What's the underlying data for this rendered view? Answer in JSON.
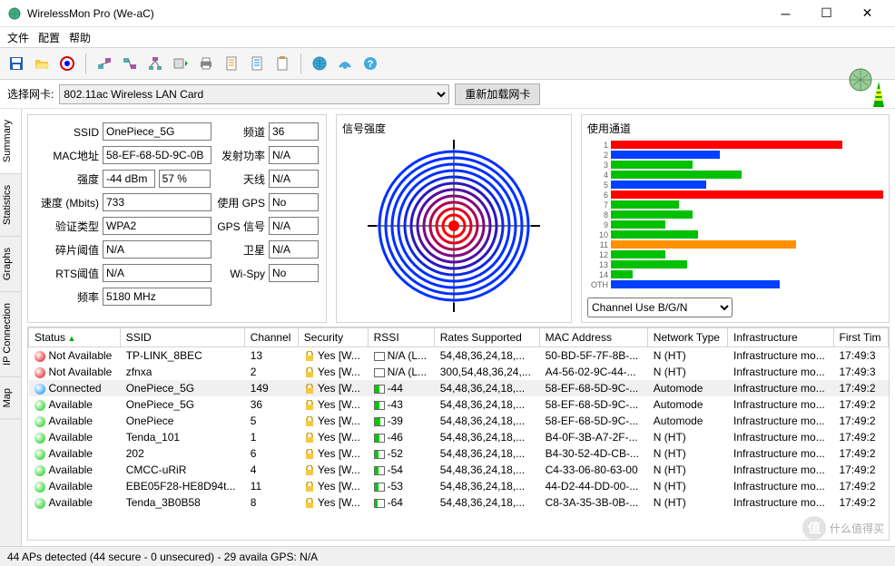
{
  "window": {
    "title": "WirelessMon Pro (We-aC)"
  },
  "menu": {
    "file": "文件",
    "config": "配置",
    "help": "帮助"
  },
  "sel": {
    "label": "选择网卡:",
    "value": "802.11ac Wireless LAN Card",
    "reload": "重新加载网卡"
  },
  "tabs": {
    "summary": "Summary",
    "statistics": "Statistics",
    "graphs": "Graphs",
    "ipconn": "IP Connection",
    "map": "Map"
  },
  "info": {
    "ssid_lbl": "SSID",
    "ssid": "OnePiece_5G",
    "mac_lbl": "MAC地址",
    "mac": "58-EF-68-5D-9C-0B",
    "str_lbl": "强度",
    "str_dbm": "-44 dBm",
    "str_pct": "57 %",
    "speed_lbl": "速度 (Mbits)",
    "speed": "733",
    "auth_lbl": "验证类型",
    "auth": "WPA2",
    "frag_lbl": "碎片阈值",
    "frag": "N/A",
    "rts_lbl": "RTS阈值",
    "rts": "N/A",
    "freq_lbl": "频率",
    "freq": "5180 MHz",
    "chan_lbl": "频道",
    "chan": "36",
    "tx_lbl": "发射功率",
    "tx": "N/A",
    "ant_lbl": "天线",
    "ant": "N/A",
    "gps_lbl": "使用 GPS",
    "gps": "No",
    "gpssig_lbl": "GPS 信号",
    "gpssig": "N/A",
    "sat_lbl": "卫星",
    "sat": "N/A",
    "wispy_lbl": "Wi-Spy",
    "wispy": "No"
  },
  "radar": {
    "title": "信号强度"
  },
  "channels": {
    "title": "使用通道",
    "select": "Channel Use B/G/N"
  },
  "chart_data": {
    "type": "bar",
    "title": "使用通道",
    "xlabel": "",
    "ylabel": "Channel",
    "xlim": [
      0,
      100
    ],
    "categories": [
      "1",
      "2",
      "3",
      "4",
      "5",
      "6",
      "7",
      "8",
      "9",
      "10",
      "11",
      "12",
      "13",
      "14",
      "OTH"
    ],
    "series": [
      {
        "name": "primary",
        "colors": [
          "#ff0000",
          "#0040ff",
          "#00c000",
          "#00c000",
          "#0040ff",
          "#ff0000",
          "#00c000",
          "#00c000",
          "#00c000",
          "#00c000",
          "#ff9000",
          "#00c000",
          "#00c000",
          "#00c000",
          "#0040ff"
        ],
        "values": [
          85,
          40,
          30,
          48,
          35,
          100,
          25,
          30,
          20,
          32,
          68,
          20,
          28,
          8,
          62
        ]
      }
    ]
  },
  "grid": {
    "cols": [
      "Status",
      "SSID",
      "Channel",
      "Security",
      "RSSI",
      "Rates Supported",
      "MAC Address",
      "Network Type",
      "Infrastructure",
      "First Tim"
    ],
    "rows": [
      {
        "status": "Not Available",
        "color": "#d00",
        "ssid": "TP-LINK_8BEC",
        "chan": "13",
        "sec": "Yes [W...",
        "rssi": "N/A (L...",
        "rfill": 0,
        "rates": "54,48,36,24,18,...",
        "mac": "50-BD-5F-7F-8B-...",
        "nt": "N (HT)",
        "infra": "Infrastructure mo...",
        "ft": "17:49:3"
      },
      {
        "status": "Not Available",
        "color": "#d00",
        "ssid": "zfnxa",
        "chan": "2",
        "sec": "Yes [W...",
        "rssi": "N/A (L...",
        "rfill": 0,
        "rates": "300,54,48,36,24,...",
        "mac": "A4-56-02-9C-44-...",
        "nt": "N (HT)",
        "infra": "Infrastructure mo...",
        "ft": "17:49:3"
      },
      {
        "status": "Connected",
        "color": "#08f",
        "ssid": "OnePiece_5G",
        "chan": "149",
        "sec": "Yes [W...",
        "rssi": "-44",
        "rfill": 55,
        "rates": "54,48,36,24,18,...",
        "mac": "58-EF-68-5D-9C-...",
        "nt": "Automode",
        "infra": "Infrastructure mo...",
        "ft": "17:49:2",
        "sel": true
      },
      {
        "status": "Available",
        "color": "#0c0",
        "ssid": "OnePiece_5G",
        "chan": "36",
        "sec": "Yes [W...",
        "rssi": "-43",
        "rfill": 56,
        "rates": "54,48,36,24,18,...",
        "mac": "58-EF-68-5D-9C-...",
        "nt": "Automode",
        "infra": "Infrastructure mo...",
        "ft": "17:49:2"
      },
      {
        "status": "Available",
        "color": "#0c0",
        "ssid": "OnePiece",
        "chan": "5",
        "sec": "Yes [W...",
        "rssi": "-39",
        "rfill": 60,
        "rates": "54,48,36,24,18,...",
        "mac": "58-EF-68-5D-9C-...",
        "nt": "Automode",
        "infra": "Infrastructure mo...",
        "ft": "17:49:2"
      },
      {
        "status": "Available",
        "color": "#0c0",
        "ssid": "Tenda_101",
        "chan": "1",
        "sec": "Yes [W...",
        "rssi": "-46",
        "rfill": 52,
        "rates": "54,48,36,24,18,...",
        "mac": "B4-0F-3B-A7-2F-...",
        "nt": "N (HT)",
        "infra": "Infrastructure mo...",
        "ft": "17:49:2"
      },
      {
        "status": "Available",
        "color": "#0c0",
        "ssid": "202",
        "chan": "6",
        "sec": "Yes [W...",
        "rssi": "-52",
        "rfill": 46,
        "rates": "54,48,36,24,18,...",
        "mac": "B4-30-52-4D-CB-...",
        "nt": "N (HT)",
        "infra": "Infrastructure mo...",
        "ft": "17:49:2"
      },
      {
        "status": "Available",
        "color": "#0c0",
        "ssid": "CMCC-uRiR",
        "chan": "4",
        "sec": "Yes [W...",
        "rssi": "-54",
        "rfill": 44,
        "rates": "54,48,36,24,18,...",
        "mac": "C4-33-06-80-63-00",
        "nt": "N (HT)",
        "infra": "Infrastructure mo...",
        "ft": "17:49:2"
      },
      {
        "status": "Available",
        "color": "#0c0",
        "ssid": "EBE05F28-HE8D94t...",
        "chan": "11",
        "sec": "Yes [W...",
        "rssi": "-53",
        "rfill": 45,
        "rates": "54,48,36,24,18,...",
        "mac": "44-D2-44-DD-00-...",
        "nt": "N (HT)",
        "infra": "Infrastructure mo...",
        "ft": "17:49:2"
      },
      {
        "status": "Available",
        "color": "#0c0",
        "ssid": "Tenda_3B0B58",
        "chan": "8",
        "sec": "Yes [W...",
        "rssi": "-64",
        "rfill": 34,
        "rates": "54,48,36,24,18,...",
        "mac": "C8-3A-35-3B-0B-...",
        "nt": "N (HT)",
        "infra": "Infrastructure mo...",
        "ft": "17:49:2"
      }
    ]
  },
  "status": {
    "text": "44 APs detected (44 secure - 0 unsecured) - 29 availa GPS: N/A"
  },
  "watermark": "什么值得买"
}
